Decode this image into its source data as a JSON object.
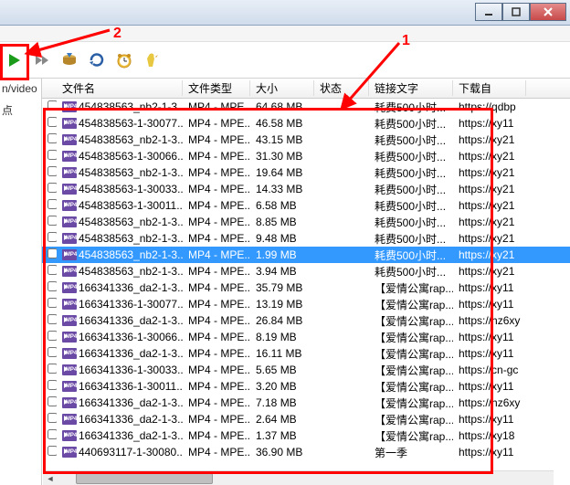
{
  "window": {
    "min": "─",
    "max": "☐",
    "close": "✕"
  },
  "sidebar": {
    "items": [
      "n/video",
      "点"
    ]
  },
  "columns": {
    "name": "文件名",
    "type": "文件类型",
    "size": "大小",
    "status": "状态",
    "link": "链接文字",
    "download": "下载自"
  },
  "rows": [
    {
      "name": "454838563_nb2-1-3...",
      "type": "MP4 - MPE...",
      "size": "64.68  MB",
      "link": "耗费500小时...",
      "dl": "https://qdbp"
    },
    {
      "name": "454838563-1-30077...",
      "type": "MP4 - MPE...",
      "size": "46.58  MB",
      "link": "耗费500小时...",
      "dl": "https://xy11"
    },
    {
      "name": "454838563_nb2-1-3...",
      "type": "MP4 - MPE...",
      "size": "43.15  MB",
      "link": "耗费500小时...",
      "dl": "https://xy21"
    },
    {
      "name": "454838563-1-30066...",
      "type": "MP4 - MPE...",
      "size": "31.30  MB",
      "link": "耗费500小时...",
      "dl": "https://xy21"
    },
    {
      "name": "454838563_nb2-1-3...",
      "type": "MP4 - MPE...",
      "size": "19.64  MB",
      "link": "耗费500小时...",
      "dl": "https://xy21"
    },
    {
      "name": "454838563-1-30033...",
      "type": "MP4 - MPE...",
      "size": "14.33  MB",
      "link": "耗费500小时...",
      "dl": "https://xy21"
    },
    {
      "name": "454838563-1-30011...",
      "type": "MP4 - MPE...",
      "size": "6.58  MB",
      "link": "耗费500小时...",
      "dl": "https://xy21"
    },
    {
      "name": "454838563_nb2-1-3...",
      "type": "MP4 - MPE...",
      "size": "8.85  MB",
      "link": "耗费500小时...",
      "dl": "https://xy21"
    },
    {
      "name": "454838563_nb2-1-3...",
      "type": "MP4 - MPE...",
      "size": "9.48  MB",
      "link": "耗费500小时...",
      "dl": "https://xy21"
    },
    {
      "name": "454838563_nb2-1-3...",
      "type": "MP4 - MPE...",
      "size": "1.99  MB",
      "link": "耗费500小时...",
      "dl": "https://xy21",
      "sel": true
    },
    {
      "name": "454838563_nb2-1-3...",
      "type": "MP4 - MPE...",
      "size": "3.94  MB",
      "link": "耗费500小时...",
      "dl": "https://xy21"
    },
    {
      "name": "166341336_da2-1-3...",
      "type": "MP4 - MPE...",
      "size": "35.79  MB",
      "link": "【爱情公寓rap...",
      "dl": "https://xy11"
    },
    {
      "name": "166341336-1-30077...",
      "type": "MP4 - MPE...",
      "size": "13.19  MB",
      "link": "【爱情公寓rap...",
      "dl": "https://xy11"
    },
    {
      "name": "166341336_da2-1-3...",
      "type": "MP4 - MPE...",
      "size": "26.84  MB",
      "link": "【爱情公寓rap...",
      "dl": "https://hz6xy"
    },
    {
      "name": "166341336-1-30066...",
      "type": "MP4 - MPE...",
      "size": "8.19  MB",
      "link": "【爱情公寓rap...",
      "dl": "https://xy11"
    },
    {
      "name": "166341336_da2-1-3...",
      "type": "MP4 - MPE...",
      "size": "16.11  MB",
      "link": "【爱情公寓rap...",
      "dl": "https://xy11"
    },
    {
      "name": "166341336-1-30033...",
      "type": "MP4 - MPE...",
      "size": "5.65  MB",
      "link": "【爱情公寓rap...",
      "dl": "https://cn-gc"
    },
    {
      "name": "166341336-1-30011...",
      "type": "MP4 - MPE...",
      "size": "3.20  MB",
      "link": "【爱情公寓rap...",
      "dl": "https://xy11"
    },
    {
      "name": "166341336_da2-1-3...",
      "type": "MP4 - MPE...",
      "size": "7.18  MB",
      "link": "【爱情公寓rap...",
      "dl": "https://hz6xy"
    },
    {
      "name": "166341336_da2-1-3...",
      "type": "MP4 - MPE...",
      "size": "2.64  MB",
      "link": "【爱情公寓rap...",
      "dl": "https://xy11"
    },
    {
      "name": "166341336_da2-1-3...",
      "type": "MP4 - MPE...",
      "size": "1.37  MB",
      "link": "【爱情公寓rap...",
      "dl": "https://xy18"
    },
    {
      "name": "440693117-1-30080...",
      "type": "MP4 - MPE...",
      "size": "36.90  MB",
      "link": "第一季",
      "dl": "https://xy11"
    }
  ],
  "annotations": {
    "one": "1",
    "two": "2"
  }
}
